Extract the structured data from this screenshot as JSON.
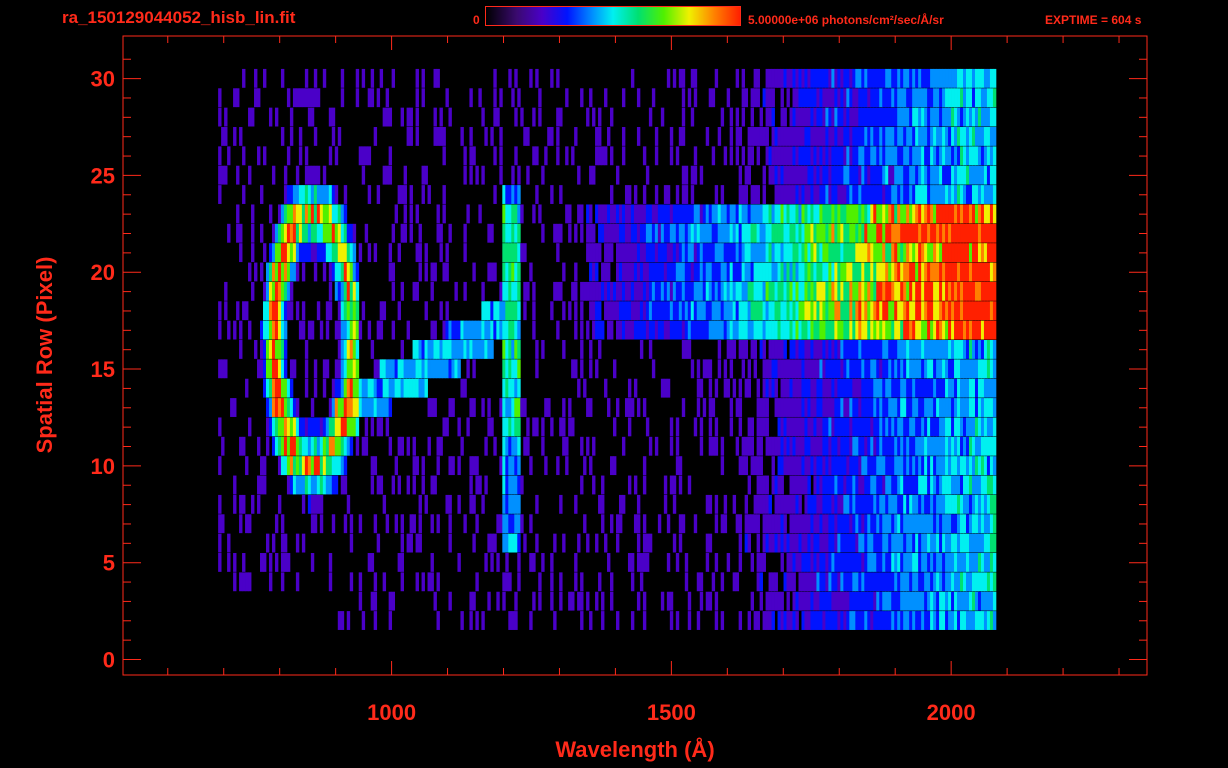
{
  "header": {
    "filename": "ra_150129044052_hisb_lin.fit",
    "colorbar_min": "0",
    "colorbar_max": "5.00000e+06 photons/cm²/sec/Å/sr",
    "exptime": "EXPTIME = 604 s"
  },
  "colors": {
    "axis": "#ff2a1a",
    "background": "#000000"
  },
  "chart_data": {
    "type": "heatmap",
    "title": "ra_150129044052_hisb_lin.fit",
    "xlabel": "Wavelength (Å)",
    "ylabel": "Spatial Row (Pixel)",
    "xlim": [
      520,
      2350
    ],
    "ylim": [
      -0.8,
      32.2
    ],
    "x_ticks": [
      1000,
      1500,
      2000
    ],
    "y_ticks": [
      0,
      5,
      10,
      15,
      20,
      25,
      30
    ],
    "value_range": [
      0,
      5000000
    ],
    "value_unit": "photons/cm²/sec/Å/sr",
    "grid": false,
    "colormap": [
      "#3a0a6e",
      "#4a00c8",
      "#0014ff",
      "#0090ff",
      "#00f0f0",
      "#00e070",
      "#50f000",
      "#f0f000",
      "#ff8000",
      "#ff2000"
    ],
    "data_extent": {
      "x": [
        690,
        2080
      ],
      "rows": [
        2,
        30
      ]
    },
    "features": [
      {
        "name": "bright arc near 800-900 Å",
        "x": [
          780,
          900
        ],
        "rows": [
          10,
          23
        ],
        "peak": 4800000
      },
      {
        "name": "vertical emission line near 1216 Å",
        "x": [
          1205,
          1225
        ],
        "rows": [
          6,
          24
        ],
        "peak": 2600000
      },
      {
        "name": "bright band at long wavelengths",
        "x": [
          1500,
          2070
        ],
        "rows": [
          17,
          23
        ],
        "peak": 4200000
      }
    ]
  }
}
